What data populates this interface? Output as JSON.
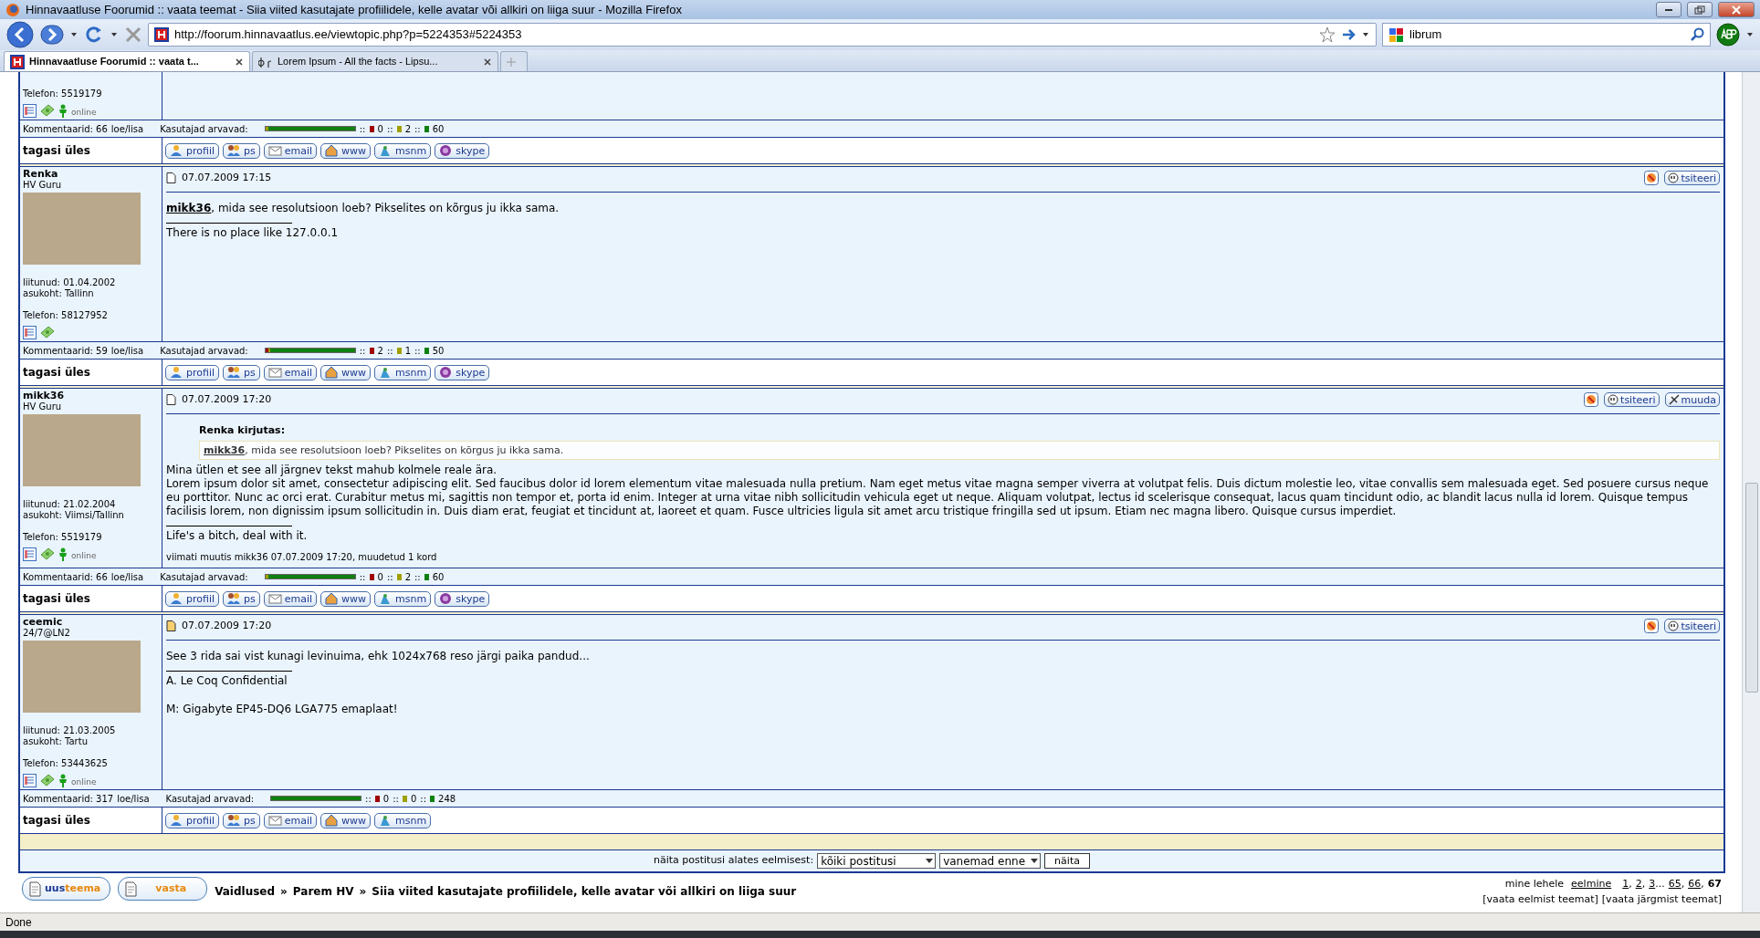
{
  "window": {
    "title": "Hinnavaatluse Foorumid :: vaata teemat - Siia viited kasutajate profiilidele, kelle avatar või allkiri on liiga suur - Mozilla Firefox"
  },
  "toolbar": {
    "url": "http://foorum.hinnavaatlus.ee/viewtopic.php?p=5224353#5224353",
    "search": "librum"
  },
  "tabs": [
    {
      "label": "Hinnavaatluse Foorumid :: vaata t...",
      "selected": true
    },
    {
      "label": "Lorem Ipsum - All the facts - Lipsu...",
      "selected": false
    }
  ],
  "posts": [
    {
      "phone": "Telefon: 5519179",
      "presence": "online",
      "comments": "Kommentaarid: 66",
      "comments_link": "loe/lisa",
      "rating_label": "Kasutajad arvavad:",
      "rating_sep": "::",
      "ratings": [
        {
          "value": "0",
          "color": "#a00000"
        },
        {
          "value": "2",
          "color": "#a0a000"
        },
        {
          "value": "60",
          "color": "#108010"
        }
      ],
      "back": "tagasi üles",
      "contacts": [
        "profiil",
        "ps",
        "email",
        "www",
        "msnm",
        "skype"
      ]
    },
    {
      "author": "Renka",
      "rank": "HV Guru",
      "joined": "liitunud: 01.04.2002",
      "location": "asukoht: Tallinn",
      "phone": "Telefon: 58127952",
      "date": "07.07.2009 17:15",
      "new": false,
      "actions": [
        {
          "kind": "report"
        },
        {
          "kind": "quote",
          "label": "tsiteeri"
        }
      ],
      "body": [
        "**mikk36**, mida see resolutsioon loeb? Pikselites on kõrgus ju ikka sama."
      ],
      "signature": [
        "There is no place like 127.0.0.1"
      ],
      "comments": "Kommentaarid: 59",
      "comments_link": "loe/lisa",
      "rating_label": "Kasutajad arvavad:",
      "rating_sep": "::",
      "ratings": [
        {
          "value": "2",
          "color": "#a00000"
        },
        {
          "value": "1",
          "color": "#a0a000"
        },
        {
          "value": "50",
          "color": "#108010"
        }
      ],
      "back": "tagasi üles",
      "contacts": [
        "profiil",
        "ps",
        "email",
        "www",
        "msnm",
        "skype"
      ]
    },
    {
      "author": "mikk36",
      "rank": "HV Guru",
      "joined": "liitunud: 21.02.2004",
      "location": "asukoht: Viimsi/Tallinn",
      "phone": "Telefon: 5519179",
      "presence": "online",
      "date": "07.07.2009 17:20",
      "new": false,
      "actions": [
        {
          "kind": "report"
        },
        {
          "kind": "quote",
          "label": "tsiteeri"
        },
        {
          "kind": "edit",
          "label": "muuda"
        }
      ],
      "quote": {
        "author": "Renka kirjutas:",
        "text": "**mikk36**, mida see resolutsioon loeb? Pikselites on kõrgus ju ikka sama."
      },
      "body": [
        "Mina ütlen et see all järgnev tekst mahub kolmele reale ära.",
        "Lorem ipsum dolor sit amet, consectetur adipiscing elit. Sed faucibus dolor id lorem elementum vitae malesuada nulla pretium. Nam eget metus vitae magna semper viverra at volutpat felis. Duis dictum molestie leo, vitae convallis sem malesuada eget. Sed posuere cursus neque eu porttitor. Nunc ac orci erat. Curabitur metus mi, sagittis non tempor et, porta id enim. Integer at urna vitae nibh sollicitudin vehicula eget ut neque. Aliquam volutpat, lectus id scelerisque consequat, lacus quam tincidunt odio, ac blandit lacus nulla id lorem. Quisque tempus facilisis lorem, non dignissim ipsum sollicitudin in. Duis diam erat, feugiat et tincidunt at, laoreet et quam. Fusce ultricies ligula sit amet arcu tristique fringilla sed ut ipsum. Etiam nec magna libero. Quisque cursus imperdiet."
      ],
      "signature": [
        "Life's a bitch, deal with it."
      ],
      "edited": "viimati muutis mikk36 07.07.2009 17:20, muudetud 1 kord",
      "comments": "Kommentaarid: 66",
      "comments_link": "loe/lisa",
      "rating_label": "Kasutajad arvavad:",
      "rating_sep": "::",
      "ratings": [
        {
          "value": "0",
          "color": "#a00000"
        },
        {
          "value": "2",
          "color": "#a0a000"
        },
        {
          "value": "60",
          "color": "#108010"
        }
      ],
      "back": "tagasi üles",
      "contacts": [
        "profiil",
        "ps",
        "email",
        "www",
        "msnm",
        "skype"
      ]
    },
    {
      "author": "ceemic",
      "rank": "24/7@LN2",
      "joined": "liitunud: 21.03.2005",
      "location": "asukoht: Tartu",
      "phone": "Telefon: 53443625",
      "presence": "online",
      "date": "07.07.2009 17:20",
      "new": true,
      "actions": [
        {
          "kind": "report"
        },
        {
          "kind": "quote",
          "label": "tsiteeri"
        }
      ],
      "body": [
        "See 3 rida sai vist kunagi levinuima, ehk 1024x768 reso järgi paika pandud..."
      ],
      "signature": [
        "A. Le Coq Confidential",
        "M: Gigabyte EP45-DQ6 LGA775 emaplaat!"
      ],
      "comments": "Kommentaarid: 317",
      "comments_link": "loe/lisa",
      "rating_label": "Kasutajad arvavad:",
      "rating_sep": "::",
      "ratings": [
        {
          "value": "0",
          "color": "#a00000"
        },
        {
          "value": "0",
          "color": "#a0a000"
        },
        {
          "value": "248",
          "color": "#108010"
        }
      ],
      "back": "tagasi üles",
      "contacts": [
        "profiil",
        "ps",
        "email",
        "www",
        "msnm"
      ]
    }
  ],
  "sort": {
    "label": "näita postitusi alates eelmisest:",
    "range": "kõiki postitusi",
    "order": "vanemad enne",
    "button": "näita"
  },
  "actions": {
    "new_topic": [
      "uus",
      "teema"
    ],
    "reply": "vasta"
  },
  "breadcrumbs": [
    {
      "label": "Vaidlused",
      "sep": "»"
    },
    {
      "label": "Parem HV",
      "sep": "»"
    },
    {
      "label": "Siia viited kasutajate profiilidele, kelle avatar või allkiri on liiga suur"
    }
  ],
  "pagination": {
    "label": "mine lehele",
    "items": [
      {
        "kind": "link",
        "label": "eelmine"
      },
      {
        "kind": "link",
        "label": "1"
      },
      {
        "kind": "text",
        "label": ","
      },
      {
        "kind": "link",
        "label": "2"
      },
      {
        "kind": "text",
        "label": ","
      },
      {
        "kind": "link",
        "label": "3"
      },
      {
        "kind": "text",
        "label": "..."
      },
      {
        "kind": "link",
        "label": "65"
      },
      {
        "kind": "text",
        "label": ","
      },
      {
        "kind": "link",
        "label": "66"
      },
      {
        "kind": "text",
        "label": ","
      },
      {
        "kind": "current",
        "label": "67"
      }
    ],
    "prev_topic": "[vaata eelmist teemat]",
    "next_topic": "[vaata järgmist teemat]"
  },
  "status_bar": "Done"
}
